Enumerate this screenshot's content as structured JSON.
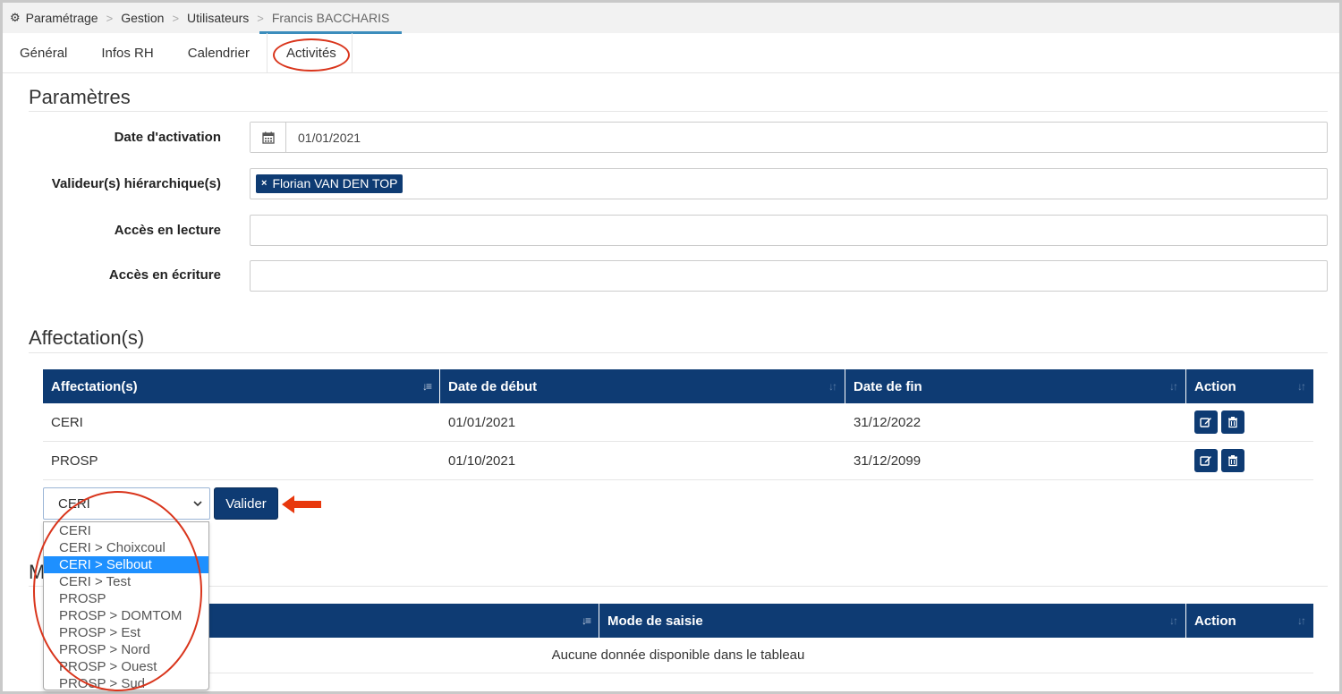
{
  "breadcrumb": {
    "items": [
      "Paramétrage",
      "Gestion",
      "Utilisateurs",
      "Francis BACCHARIS"
    ],
    "separator": ">"
  },
  "tabs": [
    "Général",
    "Infos RH",
    "Calendrier",
    "Activités"
  ],
  "active_tab": "Activités",
  "parametres": {
    "title": "Paramètres",
    "date_activation_label": "Date d'activation",
    "date_activation_value": "01/01/2021",
    "valideurs_label": "Valideur(s) hiérarchique(s)",
    "valideur_tag": "Florian VAN DEN TOP",
    "tag_remove": "×",
    "acces_lecture_label": "Accès en lecture",
    "acces_ecriture_label": "Accès en écriture"
  },
  "affectations": {
    "title": "Affectation(s)",
    "columns": [
      "Affectation(s)",
      "Date de début",
      "Date de fin",
      "Action"
    ],
    "rows": [
      {
        "affectation": "CERI",
        "debut": "01/01/2021",
        "fin": "31/12/2022"
      },
      {
        "affectation": "PROSP",
        "debut": "01/10/2021",
        "fin": "31/12/2099"
      }
    ],
    "select_value": "CERI",
    "valider_label": "Valider",
    "options": [
      "CERI",
      "CERI > Choixcoul",
      "CERI > Selbout",
      "CERI > Test",
      "PROSP",
      "PROSP > DOMTOM",
      "PROSP > Est",
      "PROSP > Nord",
      "PROSP > Ouest",
      "PROSP > Sud"
    ],
    "highlighted_option": "CERI > Selbout"
  },
  "section3": {
    "title_partial": "M",
    "columns": [
      "Mode de saisie",
      "Action"
    ],
    "empty_text": "Aucune donnée disponible dans le tableau"
  },
  "colors": {
    "primary": "#0e3b73",
    "annotation": "#d9351c",
    "highlight": "#1e90ff"
  },
  "icons": {
    "breadcrumb": "gear-icon",
    "date": "calendar-icon",
    "edit": "edit-icon",
    "delete": "trash-icon",
    "sort": "sort-icon",
    "select": "chevron-down-icon",
    "annotation": "arrow-left-icon"
  }
}
